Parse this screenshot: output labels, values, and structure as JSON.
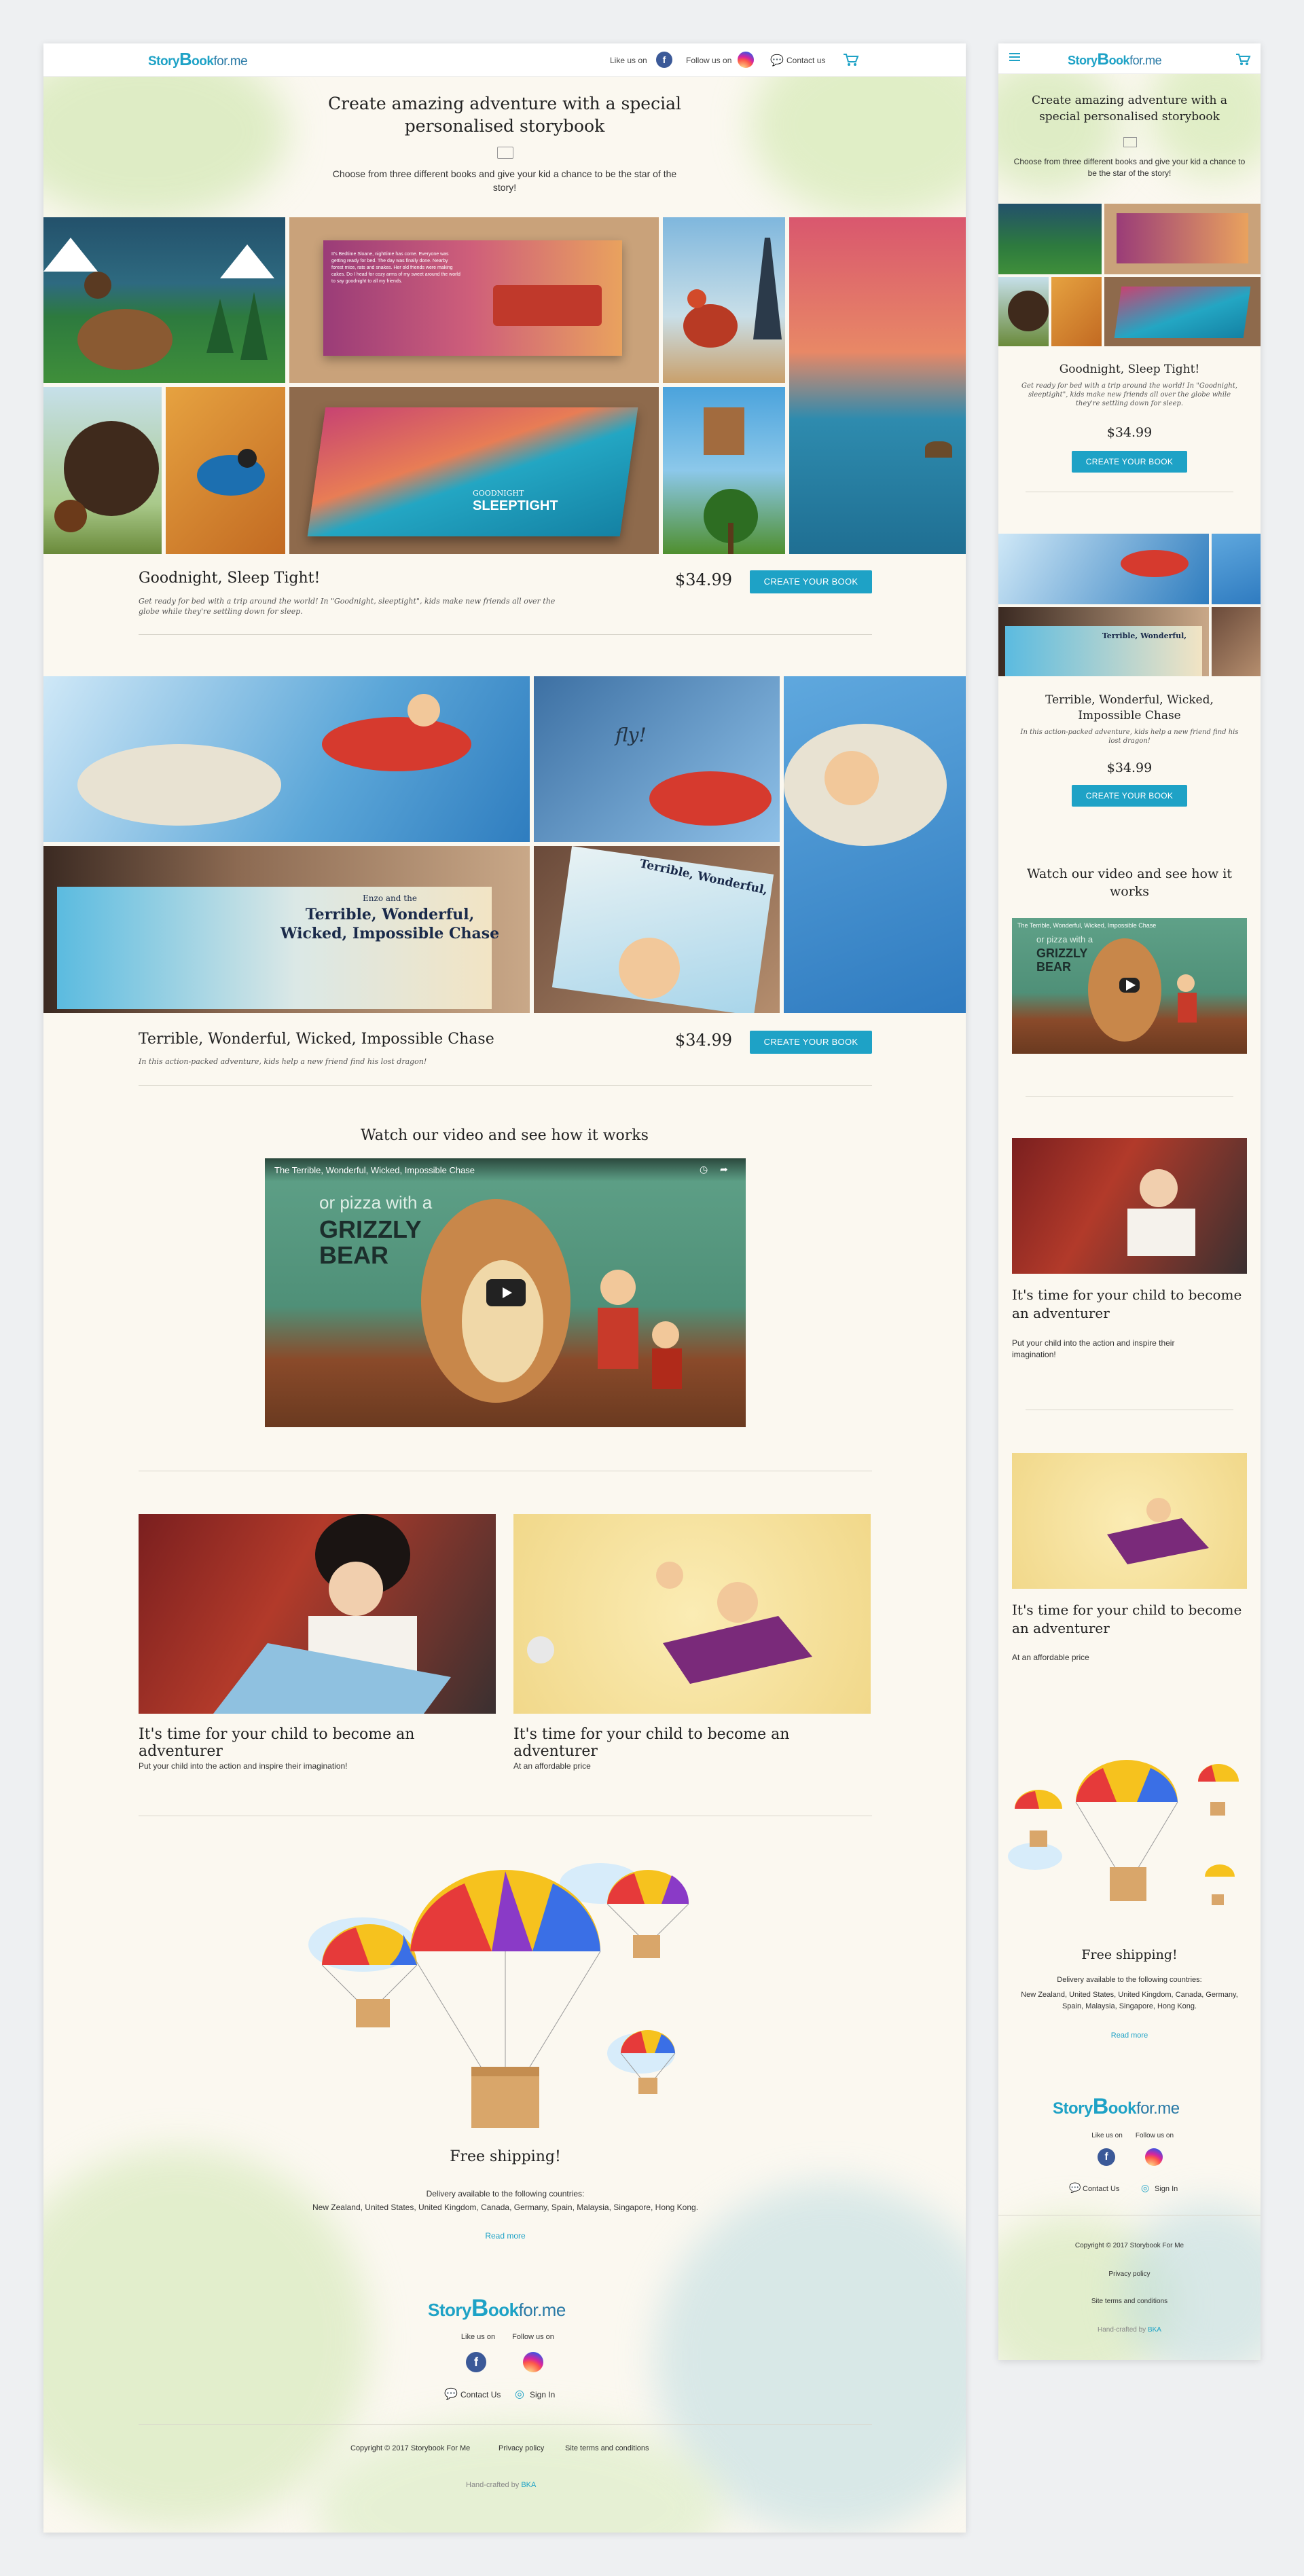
{
  "brand": {
    "story": "Story",
    "b": "B",
    "ook": "ook",
    "for_me": "for.me"
  },
  "nav": {
    "like_us": "Like us on",
    "follow_us": "Follow us on",
    "contact": "Contact us",
    "menu_icon": "hamburger-icon",
    "cart_icon": "cart-icon"
  },
  "hero": {
    "title": "Create amazing adventure with a special personalised storybook",
    "subtitle": "Choose from three different books and give your kid a chance to be the star of the story!"
  },
  "books": [
    {
      "title": "Goodnight, Sleep Tight!",
      "description": "Get ready for bed with a trip around the world! In \"Goodnight, sleeptight\", kids make new friends all over the globe while they're settling down for sleep.",
      "price": "$34.99",
      "cta": "CREATE YOUR BOOK",
      "cover_text": "SLEEPTIGHT",
      "cover_small": "GOODNIGHT",
      "spread_text": "It's Bedtime Sloane, nighttime has come. Everyone was getting ready for bed. The day was finally done. Nearby forest mice, rats and snakes. Her old friends were making cakes. Do I head for cozy arms of my sweet around the world to say goodnight to all my friends."
    },
    {
      "title": "Terrible, Wonderful, Wicked, Impossible Chase",
      "description": "In this action-packed adventure, kids help a new friend find his lost dragon!",
      "price": "$34.99",
      "cta": "CREATE YOUR BOOK",
      "cover_line1": "Enzo and the",
      "cover_line2": "Terrible, Wonderful,",
      "cover_line3": "Wicked, Impossible Chase",
      "page_word": "fly!"
    }
  ],
  "video": {
    "heading": "Watch our video and see how it works",
    "title": "The Terrible, Wonderful, Wicked, Impossible Chase",
    "caption1": "or pizza with a",
    "caption2": "GRIZZLY",
    "caption3": "BEAR"
  },
  "features": [
    {
      "title": "It's time for your child to become an adventurer",
      "text": "Put your child into the action  and inspire their imagination!"
    },
    {
      "title": "It's time for your child to become an adventurer",
      "text": "At an affordable price"
    }
  ],
  "shipping": {
    "title": "Free shipping!",
    "intro": "Delivery available to the following countries:",
    "countries": "New Zealand, United States, United Kingdom, Canada, Germany, Spain, Malaysia, Singapore, Hong Kong.",
    "read_more": "Read more"
  },
  "footer": {
    "like_us": "Like us on",
    "follow_us": "Follow us on",
    "contact": "Contact Us",
    "sign_in": "Sign In",
    "copyright": "Copyright © 2017 Storybook For Me",
    "privacy": "Privacy policy",
    "terms": "Site terms and conditions",
    "crafted": "Hand-crafted by",
    "crafted_by": "BKA"
  },
  "colors": {
    "accent": "#1ea2c6",
    "cream": "#fbf8f0",
    "facebook": "#3b5998"
  }
}
